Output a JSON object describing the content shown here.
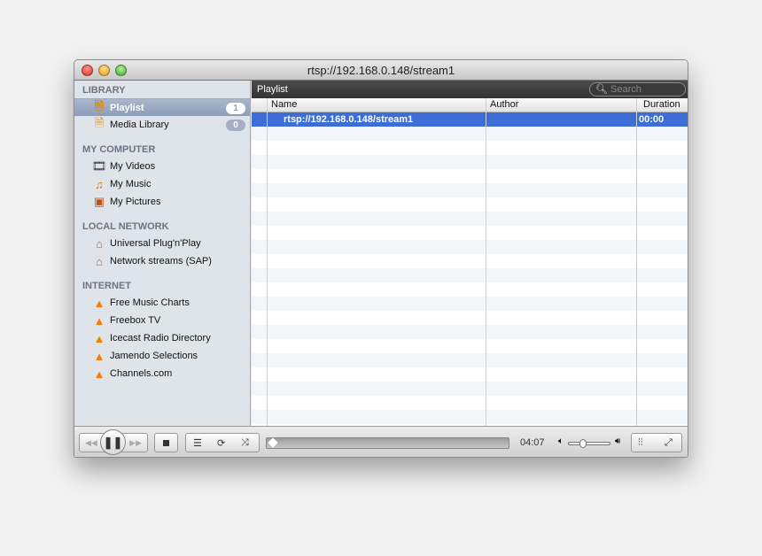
{
  "window": {
    "title": "rtsp://192.168.0.148/stream1"
  },
  "sidebar": {
    "sections": [
      {
        "title": "LIBRARY",
        "items": [
          {
            "label": "Playlist",
            "badge": "1",
            "icon": "playlist-icon",
            "selected": true
          },
          {
            "label": "Media Library",
            "badge": "0",
            "icon": "media-library-icon"
          }
        ]
      },
      {
        "title": "MY COMPUTER",
        "items": [
          {
            "label": "My Videos",
            "icon": "film-icon"
          },
          {
            "label": "My Music",
            "icon": "music-note-icon"
          },
          {
            "label": "My Pictures",
            "icon": "picture-icon"
          }
        ]
      },
      {
        "title": "LOCAL NETWORK",
        "items": [
          {
            "label": "Universal Plug'n'Play",
            "icon": "house-icon"
          },
          {
            "label": "Network streams (SAP)",
            "icon": "house-icon"
          }
        ]
      },
      {
        "title": "INTERNET",
        "items": [
          {
            "label": "Free Music Charts",
            "icon": "vlc-cone-icon"
          },
          {
            "label": "Freebox TV",
            "icon": "vlc-cone-icon"
          },
          {
            "label": "Icecast Radio Directory",
            "icon": "vlc-cone-icon"
          },
          {
            "label": "Jamendo Selections",
            "icon": "vlc-cone-icon"
          },
          {
            "label": "Channels.com",
            "icon": "vlc-cone-icon"
          }
        ]
      }
    ]
  },
  "main": {
    "header": "Playlist",
    "search_placeholder": "Search",
    "columns": [
      "Name",
      "Author",
      "Duration"
    ],
    "rows": [
      {
        "name": "rtsp://192.168.0.148/stream1",
        "author": "",
        "duration": "00:00",
        "selected": true
      }
    ]
  },
  "toolbar": {
    "time": "04:07",
    "progress": 0,
    "volume": 0.33
  },
  "colors": {
    "selection": "#3d6dd6",
    "sidebar": "#dfe3ea"
  }
}
